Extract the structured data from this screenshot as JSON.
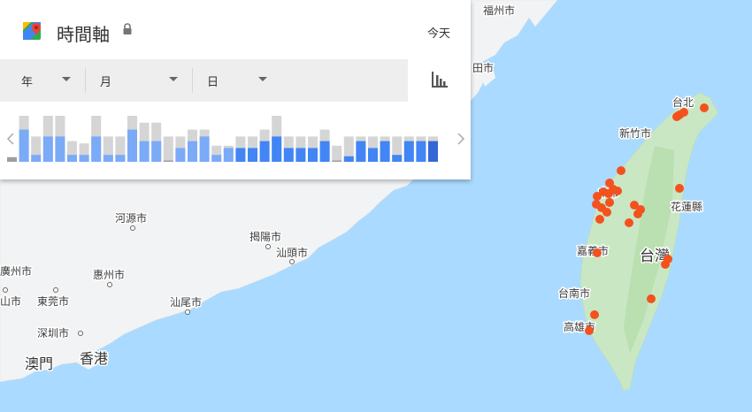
{
  "panel": {
    "title": "時間軸",
    "today_label": "今天",
    "year_label": "年",
    "month_label": "月",
    "day_label": "日",
    "icons": {
      "logo": "google-maps-icon",
      "lock": "lock-icon",
      "chart": "bar-chart-icon"
    },
    "colors": {
      "bar_active": "#4285f4",
      "bar_light": "#7baaf7",
      "bar_dark": "#3367d6",
      "bar_gray": "#d5d5d5"
    }
  },
  "histogram": {
    "bars": [
      {
        "gray": 0.1,
        "blue": 0.1,
        "tone": "none"
      },
      {
        "gray": 1.0,
        "blue": 0.7,
        "tone": "light"
      },
      {
        "gray": 0.55,
        "blue": 0.15,
        "tone": "light"
      },
      {
        "gray": 1.0,
        "blue": 0.55,
        "tone": "light"
      },
      {
        "gray": 1.0,
        "blue": 0.55,
        "tone": "light"
      },
      {
        "gray": 0.45,
        "blue": 0.15,
        "tone": "light"
      },
      {
        "gray": 0.4,
        "blue": 0.15,
        "tone": "light"
      },
      {
        "gray": 1.0,
        "blue": 0.55,
        "tone": "light"
      },
      {
        "gray": 0.55,
        "blue": 0.15,
        "tone": "light"
      },
      {
        "gray": 0.55,
        "blue": 0.15,
        "tone": "light"
      },
      {
        "gray": 1.0,
        "blue": 0.7,
        "tone": "light"
      },
      {
        "gray": 0.85,
        "blue": 0.45,
        "tone": "light"
      },
      {
        "gray": 0.85,
        "blue": 0.45,
        "tone": "light"
      },
      {
        "gray": 0.55,
        "blue": 0.02,
        "tone": "none"
      },
      {
        "gray": 0.55,
        "blue": 0.3,
        "tone": "light"
      },
      {
        "gray": 0.7,
        "blue": 0.45,
        "tone": "light"
      },
      {
        "gray": 0.7,
        "blue": 0.55,
        "tone": "light"
      },
      {
        "gray": 0.35,
        "blue": 0.15,
        "tone": "light"
      },
      {
        "gray": 0.35,
        "blue": 0.3,
        "tone": "light"
      },
      {
        "gray": 0.55,
        "blue": 0.3,
        "tone": "active"
      },
      {
        "gray": 0.55,
        "blue": 0.3,
        "tone": "active"
      },
      {
        "gray": 0.7,
        "blue": 0.45,
        "tone": "active"
      },
      {
        "gray": 1.0,
        "blue": 0.55,
        "tone": "active"
      },
      {
        "gray": 0.55,
        "blue": 0.3,
        "tone": "active"
      },
      {
        "gray": 0.55,
        "blue": 0.3,
        "tone": "active"
      },
      {
        "gray": 0.55,
        "blue": 0.3,
        "tone": "active"
      },
      {
        "gray": 0.7,
        "blue": 0.45,
        "tone": "active"
      },
      {
        "gray": 0.35,
        "blue": 0.02,
        "tone": "none"
      },
      {
        "gray": 0.55,
        "blue": 0.12,
        "tone": "active"
      },
      {
        "gray": 0.55,
        "blue": 0.45,
        "tone": "active"
      },
      {
        "gray": 0.55,
        "blue": 0.3,
        "tone": "active"
      },
      {
        "gray": 0.55,
        "blue": 0.45,
        "tone": "active"
      },
      {
        "gray": 0.55,
        "blue": 0.15,
        "tone": "active"
      },
      {
        "gray": 0.55,
        "blue": 0.45,
        "tone": "active"
      },
      {
        "gray": 0.55,
        "blue": 0.45,
        "tone": "active"
      },
      {
        "gray": 0.55,
        "blue": 0.45,
        "tone": "dark"
      }
    ]
  },
  "map": {
    "labels": {
      "fuzhou": "福州市",
      "putian": "田市",
      "taipei": "台北",
      "hsinchu": "新竹市",
      "taichung": "中市",
      "hualien": "花蓮縣",
      "taiwan": "台灣",
      "chiayi": "嘉義市",
      "tainan": "台南市",
      "kaohsiung": "高雄市",
      "heyuan": "河源市",
      "jieyang": "揭陽市",
      "shantou": "汕頭市",
      "huizhou": "惠州市",
      "shanwei": "汕尾市",
      "guangzhou": "廣州市",
      "dongguan": "東莞市",
      "foshan": "山市",
      "shenzhen": "深圳市",
      "macau": "澳門",
      "hongkong": "香港"
    },
    "marker_color": "#f4511e"
  }
}
